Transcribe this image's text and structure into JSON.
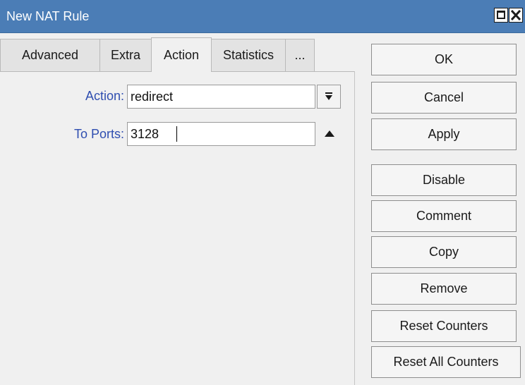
{
  "window": {
    "title": "New NAT Rule"
  },
  "tabs": [
    {
      "label": "Advanced"
    },
    {
      "label": "Extra"
    },
    {
      "label": "Action"
    },
    {
      "label": "Statistics"
    },
    {
      "label": "..."
    }
  ],
  "form": {
    "action_label": "Action:",
    "action_value": "redirect",
    "to_ports_label": "To Ports:",
    "to_ports_value": "3128"
  },
  "buttons": {
    "ok": "OK",
    "cancel": "Cancel",
    "apply": "Apply",
    "disable": "Disable",
    "comment": "Comment",
    "copy": "Copy",
    "remove": "Remove",
    "reset_counters": "Reset Counters",
    "reset_all_counters": "Reset All Counters"
  },
  "colors": {
    "titlebar": "#4b7db6",
    "label": "#2f4eb0",
    "background": "#f0f0f0"
  },
  "icons": {
    "restore": "restore-icon",
    "close": "close-icon",
    "dropdown": "dropdown-arrow-icon",
    "collapse": "triangle-up-icon"
  }
}
